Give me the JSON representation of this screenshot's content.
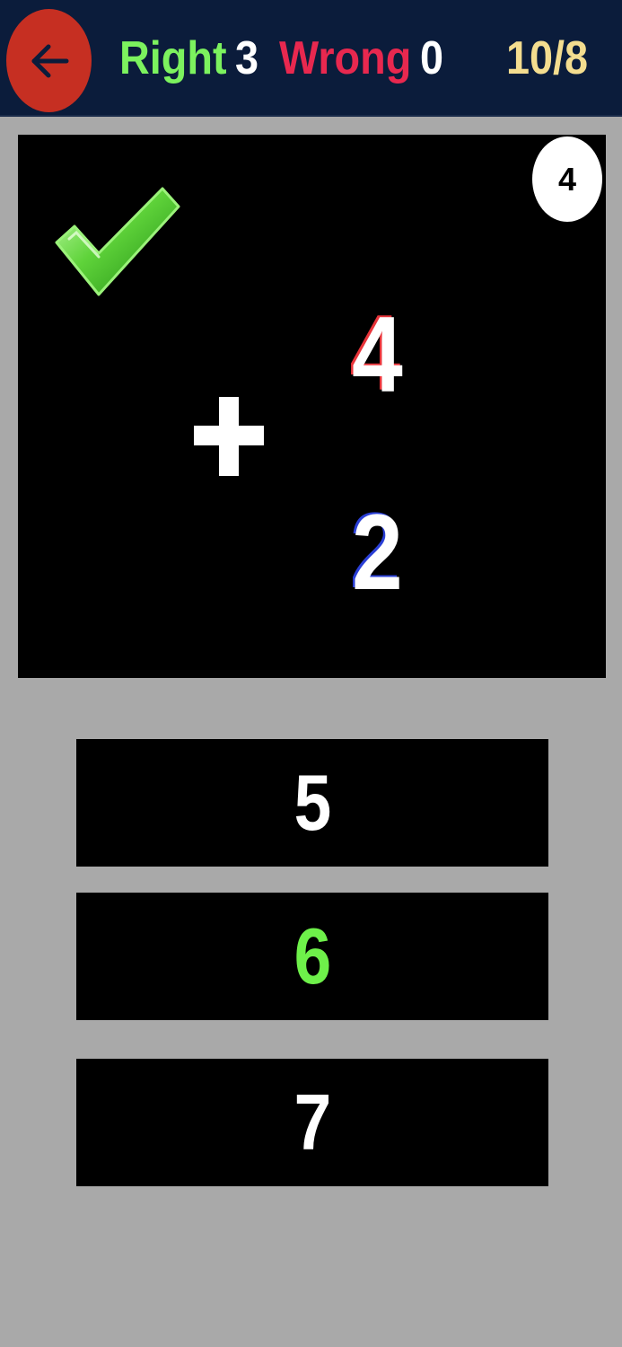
{
  "header": {
    "back_icon": "arrow-left-icon",
    "right_label": "Right",
    "right_count": "3",
    "wrong_label": "Wrong",
    "wrong_count": "0",
    "progress": "10/8"
  },
  "board": {
    "timer": "4",
    "result_icon": "checkmark-icon",
    "operator": "+",
    "operand_top": "4",
    "operand_bottom": "2"
  },
  "answers": [
    {
      "value": "5",
      "state": "normal"
    },
    {
      "value": "6",
      "state": "correct"
    },
    {
      "value": "7",
      "state": "normal"
    }
  ],
  "colors": {
    "header_bg": "#0b1c3b",
    "back_button": "#c62f22",
    "right": "#7cf25e",
    "wrong": "#e8284f",
    "progress": "#f4dd8f",
    "correct_answer": "#6ef04a",
    "page_bg": "#a9a9a9"
  }
}
